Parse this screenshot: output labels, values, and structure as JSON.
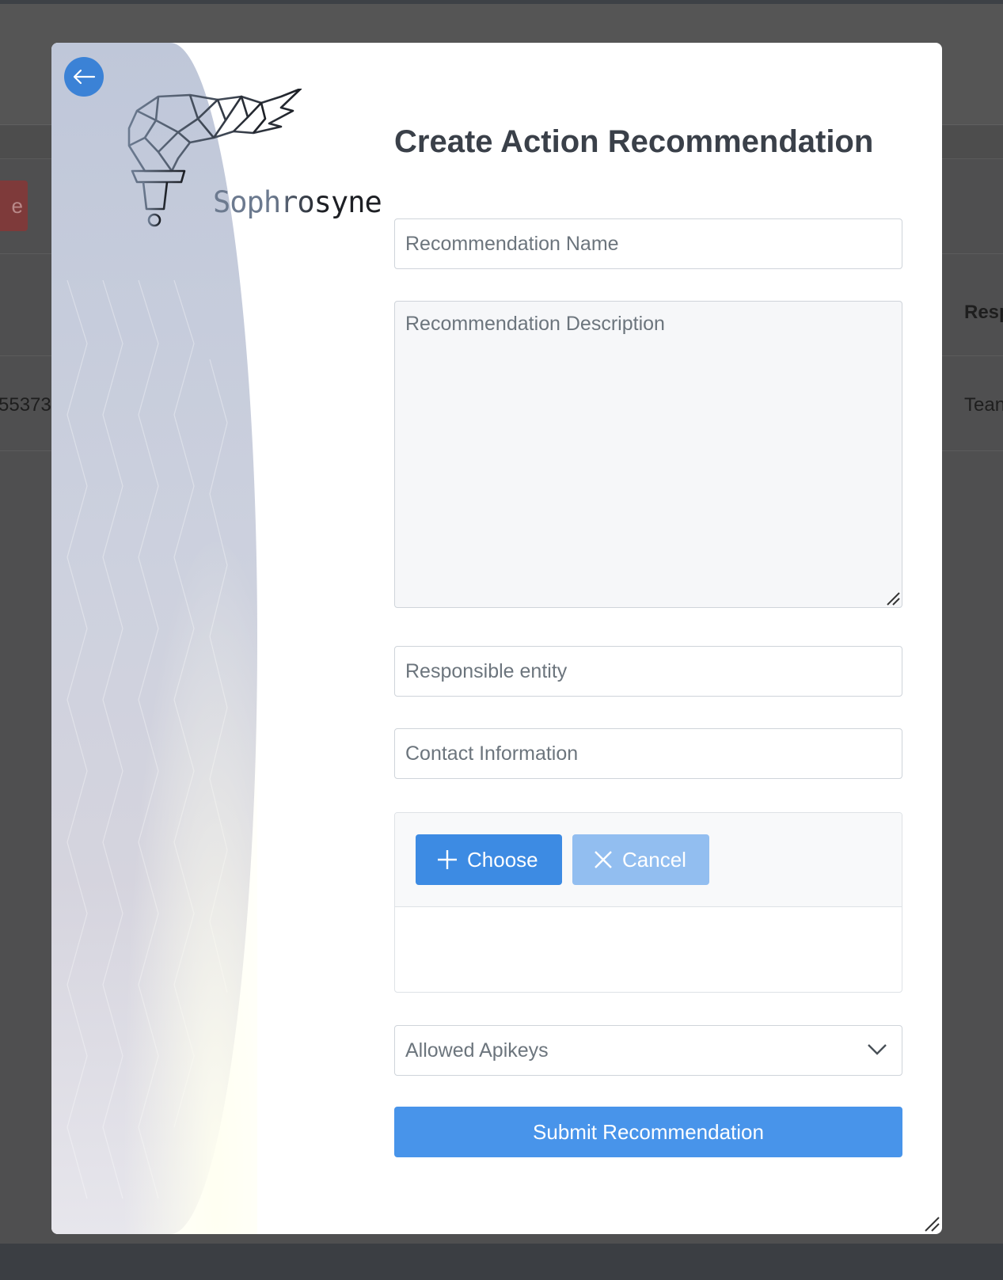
{
  "background_page": {
    "partial_button_text": "e",
    "partial_row_id": "55373",
    "partial_column_header": "Resp",
    "partial_cell_value": "Tean"
  },
  "modal": {
    "title": "Create Action Recommendation",
    "logo_text": "Sophrosyne",
    "back_icon": "arrow-left-icon",
    "fields": {
      "name_placeholder": "Recommendation Name",
      "name_value": "",
      "description_placeholder": "Recommendation Description",
      "description_value": "",
      "entity_placeholder": "Responsible entity",
      "entity_value": "",
      "contact_placeholder": "Contact Information",
      "contact_value": ""
    },
    "upload": {
      "choose_label": "Choose",
      "choose_icon": "plus-icon",
      "cancel_label": "Cancel",
      "cancel_icon": "x-icon"
    },
    "apikeys_select": {
      "placeholder": "Allowed Apikeys",
      "icon": "chevron-down-icon"
    },
    "submit_label": "Submit Recommendation"
  },
  "colors": {
    "primary": "#3d8be3",
    "primary_disabled": "#92bef0",
    "submit": "#4894ea",
    "back_button": "#3b82d6",
    "title_text": "#3a4049",
    "overlay": "#4f4f50",
    "danger_dimmed": "#7e3a3a"
  }
}
